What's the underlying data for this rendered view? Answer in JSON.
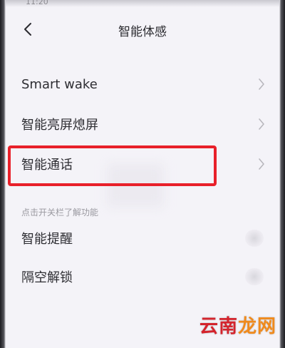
{
  "status_bar": {
    "time": "11:20"
  },
  "header": {
    "title": "智能体感",
    "back_icon": "chevron-left-icon"
  },
  "settings": {
    "items": [
      {
        "label": "Smart wake",
        "control": "chevron-right-icon"
      },
      {
        "label": "智能亮屏熄屏",
        "control": "chevron-right-icon"
      },
      {
        "label": "智能通话",
        "control": "chevron-right-icon"
      }
    ],
    "section_hint": "点击开关栏了解功能",
    "toggle_items": [
      {
        "label": "智能提醒",
        "control": "toggle-switch"
      },
      {
        "label": "隔空解锁",
        "control": "toggle-switch"
      }
    ]
  },
  "annotation": {
    "highlight_color": "#e8202a",
    "highlighted_item": "智能通话"
  },
  "watermark": {
    "part1": "云南",
    "part2": "龙网"
  },
  "colors": {
    "background": "#f4f3f8",
    "text_primary": "#2e2e33",
    "text_hint": "#9a99a0",
    "chevron": "#b8b7bd",
    "watermark_red": "#d4232c",
    "watermark_orange": "#f08a1c"
  }
}
